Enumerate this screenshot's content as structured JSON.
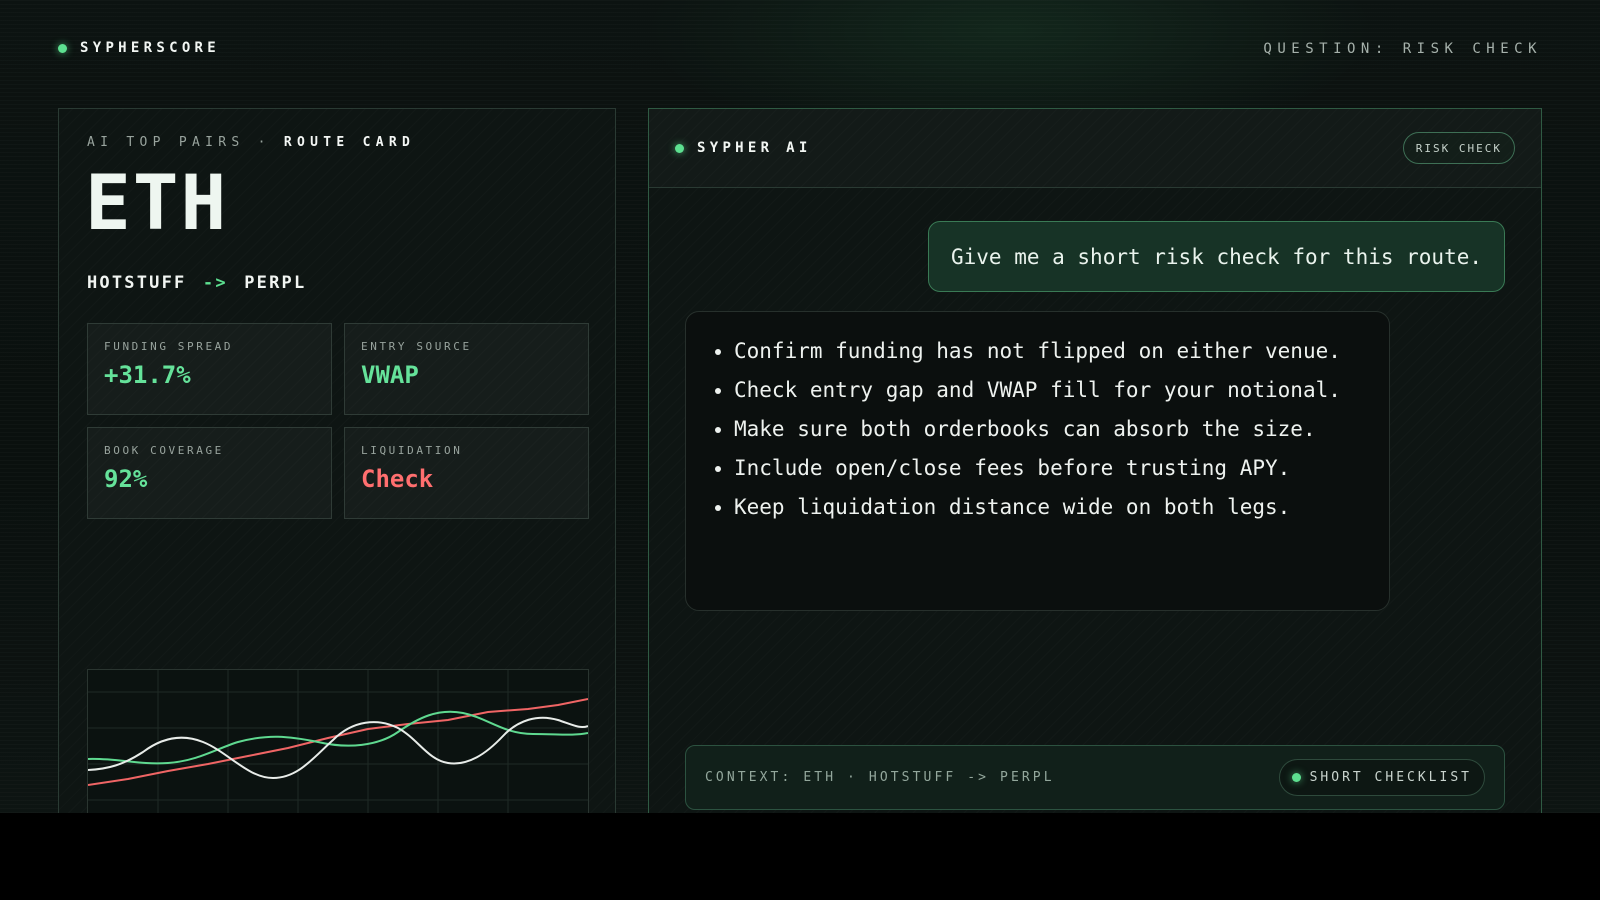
{
  "header": {
    "brand": "SYPHERSCORE",
    "question": "QUESTION: RISK CHECK"
  },
  "route_card": {
    "eyebrow_prefix": "AI TOP PAIRS ·",
    "eyebrow_strong": "ROUTE CARD",
    "asset": "ETH",
    "from_venue": "HOTSTUFF",
    "arrow": "->",
    "to_venue": "PERPL",
    "metrics": [
      {
        "label": "FUNDING SPREAD",
        "value": "+31.7%",
        "tone": "positive"
      },
      {
        "label": "ENTRY SOURCE",
        "value": "VWAP",
        "tone": "positive"
      },
      {
        "label": "BOOK COVERAGE",
        "value": "92%",
        "tone": "positive"
      },
      {
        "label": "LIQUIDATION",
        "value": "Check",
        "tone": "negative"
      }
    ],
    "sparkline_colors": {
      "white": "#e8ece9",
      "green": "#5fd990",
      "red": "#f06565"
    }
  },
  "chat": {
    "assistant_name": "SYPHER AI",
    "mode_pill": "RISK CHECK",
    "user_message": "Give me a short risk check for this route.",
    "assistant_points": [
      "Confirm funding has not flipped on either venue.",
      "Check entry gap and VWAP fill for your notional.",
      "Make sure both orderbooks can absorb the size.",
      "Include open/close fees before trusting APY.",
      "Keep liquidation distance wide on both legs."
    ],
    "context": "CONTEXT: ETH · HOTSTUFF -> PERPL",
    "checklist_label": "SHORT CHECKLIST"
  },
  "colors": {
    "accent": "#5de090",
    "negative": "#ff6f6f",
    "background": "#0c1311"
  }
}
